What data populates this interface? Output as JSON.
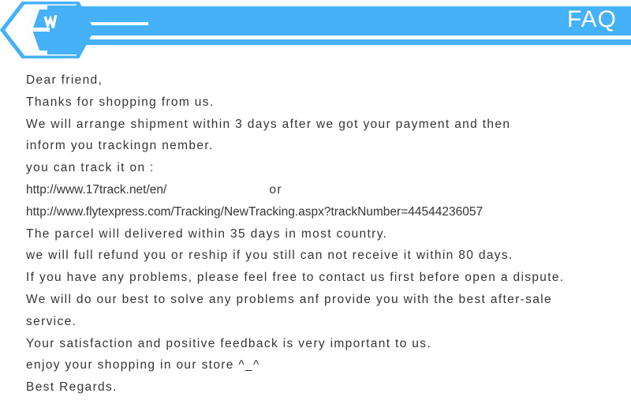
{
  "colors": {
    "accent": "#45b1f8",
    "banner_text": "#ffffff",
    "body_text": "#353535",
    "page_background": "#ffffff"
  },
  "header": {
    "title": "FAQ",
    "badge_icon": "hexagon-badge-icon",
    "decor_rule_short": "white-rule-short",
    "decor_rule_long": "white-rule-long"
  },
  "letter": {
    "lines": [
      "Dear friend,",
      "Thanks for shopping from us.",
      "We will arrange shipment within 3 days after we got your payment and then",
      "inform you trackingn nember.",
      "you can track it on :",
      "The parcel will delivered within 35 days in most country.",
      "we will full refund you or reship if you still can not receive it within 80 days.",
      "If you have any problems, please feel free to contact us first before open a dispute.",
      "We will do our best to solve any problems anf provide you with the best after-sale",
      "service.",
      "Your satisfaction and positive feedback is very important to us.",
      "enjoy your shopping in our store ^_^",
      "Best Regards."
    ],
    "tracking_url_1": "http://www.17track.net/en/",
    "or_label": "or",
    "tracking_url_2": "http://www.flytexpress.com/Tracking/NewTracking.aspx?trackNumber=44544236057",
    "tracking_number": "44544236057"
  }
}
